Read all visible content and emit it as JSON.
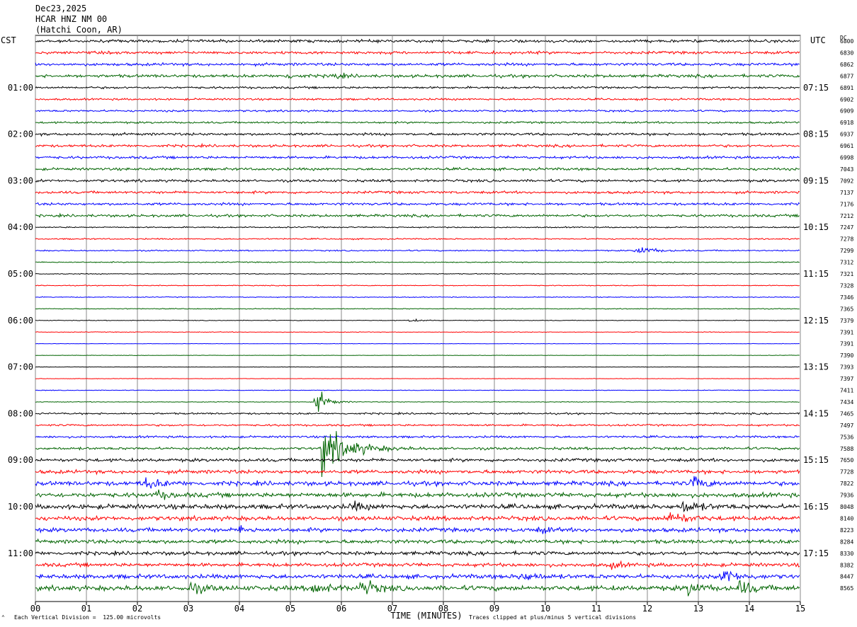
{
  "header": {
    "date": "Dec23,2025",
    "station": "HCAR HNZ NM 00",
    "location": "(Hatchi Coon, AR)"
  },
  "left_zone_label": "CST",
  "right_zone_label": "UTC",
  "dc_label": "DC",
  "footer": {
    "scale_note": "Each Vertical Division =  125.00 microvolts",
    "clip_note": "Traces clipped at plus/minus 5 vertical divisions"
  },
  "colors": {
    "trace_cycle": [
      "#000000",
      "#ff0000",
      "#0000ff",
      "#006400"
    ],
    "grid": "#888888"
  },
  "chart_data": {
    "type": "line",
    "title": "",
    "xlabel": "TIME (MINUTES)",
    "ylabel": "",
    "x_range": [
      0,
      15
    ],
    "x_ticks": [
      "00",
      "01",
      "02",
      "03",
      "04",
      "05",
      "06",
      "07",
      "08",
      "09",
      "10",
      "11",
      "12",
      "13",
      "14",
      "15"
    ],
    "grid": true,
    "rows_per_hour": 4,
    "left_hour_labels": [
      "01:00",
      "02:00",
      "03:00",
      "04:00",
      "05:00",
      "06:00",
      "07:00",
      "08:00",
      "09:00",
      "10:00",
      "11:00"
    ],
    "right_hour_labels": [
      "07:15",
      "08:15",
      "09:15",
      "10:15",
      "11:15",
      "12:15",
      "13:15",
      "14:15",
      "15:15",
      "16:15",
      "17:15"
    ],
    "dc_values": [
      "6800",
      "6830",
      "6862",
      "6877",
      "6891",
      "6902",
      "6909",
      "6918",
      "6937",
      "6961",
      "6998",
      "7043",
      "7092",
      "7137",
      "7176",
      "7212",
      "7247",
      "7278",
      "7299",
      "7312",
      "7321",
      "7328",
      "7346",
      "7365",
      "7379",
      "7391",
      "7391",
      "7390",
      "7393",
      "7397",
      "7411",
      "7434",
      "7465",
      "7497",
      "7536",
      "7588",
      "7650",
      "7728",
      "7822",
      "7936",
      "8048",
      "8140",
      "8223",
      "8284",
      "8330",
      "8382",
      "8447",
      "8565"
    ],
    "noise_levels": [
      1.3,
      1.3,
      1.3,
      1.4,
      1.0,
      0.9,
      0.9,
      0.9,
      1.2,
      1.2,
      1.2,
      1.2,
      1.2,
      1.2,
      1.2,
      1.2,
      0.6,
      0.6,
      0.6,
      0.5,
      0.4,
      0.4,
      0.4,
      0.4,
      0.3,
      0.3,
      0.2,
      0.2,
      0.2,
      0.2,
      0.3,
      0.3,
      0.8,
      0.9,
      1.0,
      1.2,
      1.5,
      1.7,
      2.0,
      2.1,
      2.2,
      2.0,
      1.9,
      1.8,
      1.7,
      1.7,
      2.0,
      2.3
    ],
    "events": [
      {
        "row": 3,
        "minute": 4.9,
        "amplitude": 3,
        "duration": 0.4
      },
      {
        "row": 3,
        "minute": 5.8,
        "amplitude": 3,
        "duration": 0.4
      },
      {
        "row": 18,
        "minute": 11.8,
        "amplitude": 5,
        "duration": 0.6
      },
      {
        "row": 24,
        "minute": 7.3,
        "amplitude": 2,
        "duration": 0.4
      },
      {
        "row": 31,
        "minute": 5.5,
        "amplitude": 14,
        "duration": 0.4
      },
      {
        "row": 35,
        "minute": 5.6,
        "amplitude": 24,
        "duration": 1.0
      },
      {
        "row": 38,
        "minute": 2.1,
        "amplitude": 6,
        "duration": 0.6
      },
      {
        "row": 38,
        "minute": 12.9,
        "amplitude": 7,
        "duration": 0.5
      },
      {
        "row": 39,
        "minute": 2.4,
        "amplitude": 4,
        "duration": 0.4
      },
      {
        "row": 40,
        "minute": 6.2,
        "amplitude": 5,
        "duration": 0.4
      },
      {
        "row": 40,
        "minute": 12.7,
        "amplitude": 6,
        "duration": 0.6
      },
      {
        "row": 41,
        "minute": 12.4,
        "amplitude": 8,
        "duration": 0.6
      },
      {
        "row": 42,
        "minute": 4.0,
        "amplitude": 5,
        "duration": 0.3
      },
      {
        "row": 42,
        "minute": 9.9,
        "amplitude": 4,
        "duration": 0.3
      },
      {
        "row": 45,
        "minute": 11.3,
        "amplitude": 4,
        "duration": 0.3
      },
      {
        "row": 46,
        "minute": 9.5,
        "amplitude": 5,
        "duration": 0.6
      },
      {
        "row": 46,
        "minute": 13.5,
        "amplitude": 8,
        "duration": 0.5
      },
      {
        "row": 47,
        "minute": 3.0,
        "amplitude": 6,
        "duration": 0.5
      },
      {
        "row": 47,
        "minute": 5.4,
        "amplitude": 7,
        "duration": 0.6
      },
      {
        "row": 47,
        "minute": 6.4,
        "amplitude": 9,
        "duration": 0.5
      },
      {
        "row": 47,
        "minute": 12.8,
        "amplitude": 6,
        "duration": 0.5
      },
      {
        "row": 47,
        "minute": 13.8,
        "amplitude": 7,
        "duration": 0.5
      }
    ]
  }
}
